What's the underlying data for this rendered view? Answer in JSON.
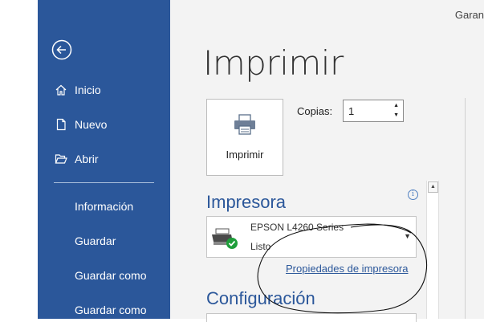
{
  "header": {
    "account_label": "Garan"
  },
  "sidebar": {
    "items": [
      {
        "label": "Inicio",
        "icon": "home-icon"
      },
      {
        "label": "Nuevo",
        "icon": "new-document-icon"
      },
      {
        "label": "Abrir",
        "icon": "open-folder-icon"
      }
    ],
    "plain_items": [
      {
        "label": "Información"
      },
      {
        "label": "Guardar"
      },
      {
        "label": "Guardar como"
      },
      {
        "label": "Guardar como"
      }
    ]
  },
  "main": {
    "title": "Imprimir",
    "print_button_label": "Imprimir",
    "copies_label": "Copias:",
    "copies_value": "1",
    "printer_section_title": "Impresora",
    "printer": {
      "name": "EPSON L4260 Series",
      "status": "Listo"
    },
    "printer_properties_link": "Propiedades de impresora",
    "settings_section_title": "Configuración"
  },
  "colors": {
    "sidebar_bg": "#2b579a",
    "accent": "#2b579a",
    "main_bg": "#f3f3f3",
    "ready_check": "#1e9e3a"
  }
}
